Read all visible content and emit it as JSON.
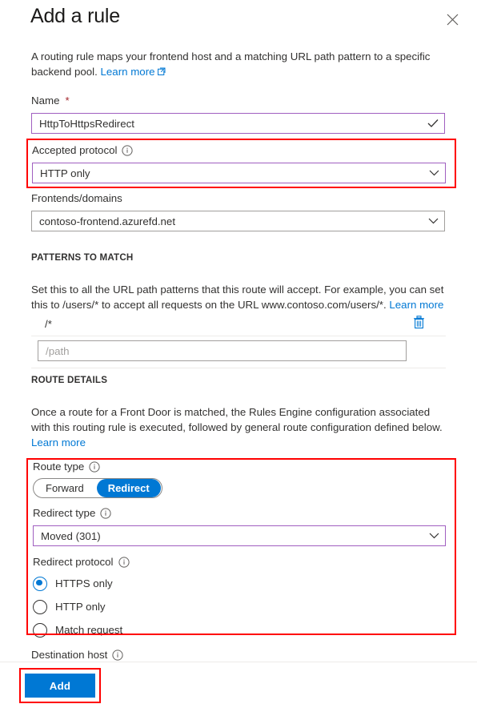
{
  "dialog": {
    "title": "Add a rule",
    "close_label": "Close",
    "intro_text": "A routing rule maps your frontend host and a matching URL path pattern to a specific backend pool.",
    "intro_link": "Learn more"
  },
  "name_field": {
    "label": "Name",
    "required_mark": "*",
    "value": "HttpToHttpsRedirect"
  },
  "accepted_protocol": {
    "label": "Accepted protocol",
    "value": "HTTP only"
  },
  "frontends": {
    "label": "Frontends/domains",
    "value": "contoso-frontend.azurefd.net"
  },
  "patterns": {
    "section_title": "PATTERNS TO MATCH",
    "description": "Set this to all the URL path patterns that this route will accept. For example, you can set this to /users/* to accept all requests on the URL www.contoso.com/users/*.",
    "description_link": "Learn more",
    "items": [
      {
        "value": "/*",
        "delete_label": "Delete pattern"
      }
    ],
    "new_placeholder": "/path",
    "new_value": ""
  },
  "route_details": {
    "section_title": "ROUTE DETAILS",
    "description": "Once a route for a Front Door is matched, the Rules Engine configuration associated with this routing rule is executed, followed by general route configuration defined below.",
    "description_link": "Learn more",
    "route_type": {
      "label": "Route type",
      "options": [
        "Forward",
        "Redirect"
      ],
      "selected": "Redirect"
    },
    "redirect_type": {
      "label": "Redirect type",
      "value": "Moved (301)"
    },
    "redirect_protocol": {
      "label": "Redirect protocol",
      "options": [
        "HTTPS only",
        "HTTP only",
        "Match request"
      ],
      "selected": "HTTPS only"
    },
    "destination_host": {
      "label": "Destination host"
    }
  },
  "footer": {
    "add_label": "Add"
  },
  "colors": {
    "accent_blue": "#0078d4",
    "annotation_red": "#ff0000",
    "focus_purple": "#a05fc0",
    "required_red": "#a4262c"
  }
}
